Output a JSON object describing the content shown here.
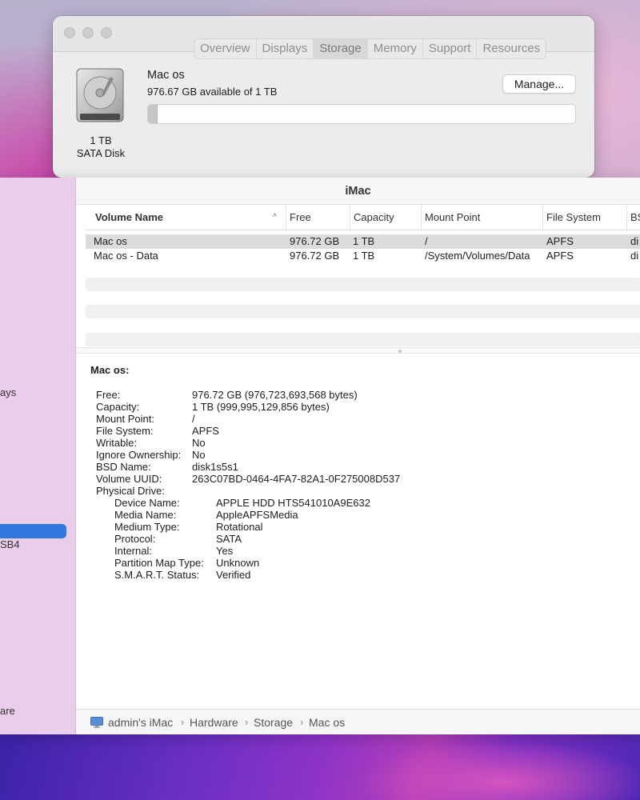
{
  "about_window": {
    "tabs": [
      "Overview",
      "Displays",
      "Storage",
      "Memory",
      "Support",
      "Resources"
    ],
    "active_tab": "Storage",
    "disk": {
      "size": "1 TB",
      "type": "SATA Disk"
    },
    "volume": {
      "name": "Mac os",
      "available": "976.67 GB available of 1 TB",
      "used_fraction": 0.023
    },
    "manage_label": "Manage..."
  },
  "sysinfo_window": {
    "title": "iMac",
    "sidebar_fragments": [
      "ays",
      "SB4",
      "are"
    ],
    "columns": [
      "Volume Name",
      "Free",
      "Capacity",
      "Mount Point",
      "File System",
      "BS"
    ],
    "rows": [
      {
        "name": "Mac os",
        "free": "976.72 GB",
        "capacity": "1 TB",
        "mount": "/",
        "fs": "APFS",
        "bsd": "di"
      },
      {
        "name": "Mac os - Data",
        "free": "976.72 GB",
        "capacity": "1 TB",
        "mount": "/System/Volumes/Data",
        "fs": "APFS",
        "bsd": "di"
      }
    ],
    "detail_title": "Mac os:",
    "details": [
      {
        "k": "Free:",
        "v": "976.72 GB (976,723,693,568 bytes)"
      },
      {
        "k": "Capacity:",
        "v": "1 TB (999,995,129,856 bytes)"
      },
      {
        "k": "Mount Point:",
        "v": "/"
      },
      {
        "k": "File System:",
        "v": "APFS"
      },
      {
        "k": "Writable:",
        "v": "No"
      },
      {
        "k": "Ignore Ownership:",
        "v": "No"
      },
      {
        "k": "BSD Name:",
        "v": "disk1s5s1"
      },
      {
        "k": "Volume UUID:",
        "v": "263C07BD-0464-4FA7-82A1-0F275008D537"
      },
      {
        "k": "Physical Drive:",
        "v": ""
      }
    ],
    "physical_drive": [
      {
        "k": "Device Name:",
        "v": "APPLE HDD HTS541010A9E632"
      },
      {
        "k": "Media Name:",
        "v": "AppleAPFSMedia"
      },
      {
        "k": "Medium Type:",
        "v": "Rotational"
      },
      {
        "k": "Protocol:",
        "v": "SATA"
      },
      {
        "k": "Internal:",
        "v": "Yes"
      },
      {
        "k": "Partition Map Type:",
        "v": "Unknown"
      },
      {
        "k": "S.M.A.R.T. Status:",
        "v": "Verified"
      }
    ],
    "breadcrumb": [
      "admin's iMac",
      "Hardware",
      "Storage",
      "Mac os"
    ],
    "separator": "›"
  }
}
